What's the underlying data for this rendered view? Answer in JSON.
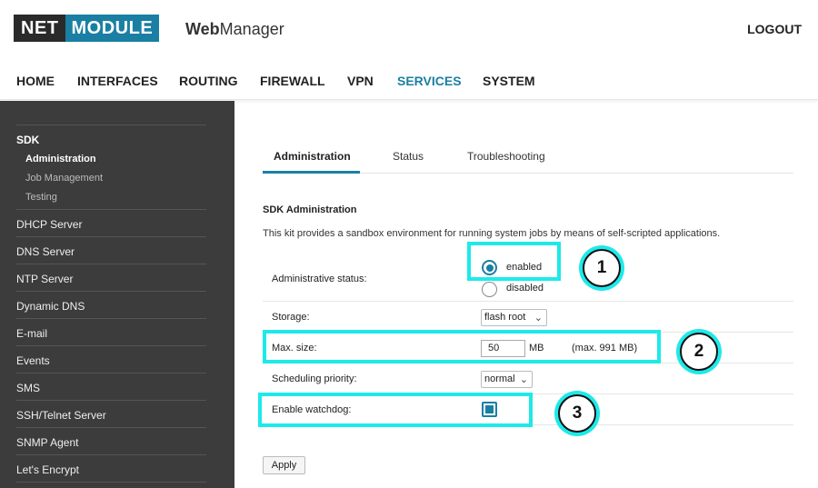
{
  "header": {
    "logo_net": "NET",
    "logo_module": "MODULE",
    "app_title_bold": "Web",
    "app_title_rest": "Manager",
    "logout": "LOGOUT"
  },
  "nav": {
    "items": [
      "HOME",
      "INTERFACES",
      "ROUTING",
      "FIREWALL",
      "VPN",
      "SERVICES",
      "SYSTEM"
    ],
    "active": "SERVICES"
  },
  "sidebar": {
    "section": "SDK",
    "sub_items": [
      "Administration",
      "Job Management",
      "Testing"
    ],
    "active_sub": "Administration",
    "items": [
      "DHCP Server",
      "DNS Server",
      "NTP Server",
      "Dynamic DNS",
      "E-mail",
      "Events",
      "SMS",
      "SSH/Telnet Server",
      "SNMP Agent",
      "Let's Encrypt"
    ]
  },
  "tabs": {
    "items": [
      "Administration",
      "Status",
      "Troubleshooting"
    ],
    "active": "Administration"
  },
  "form": {
    "title": "SDK Administration",
    "description": "This kit provides a sandbox environment for running system jobs by means of self-scripted applications.",
    "admin_status": {
      "label": "Administrative status:",
      "options": [
        "enabled",
        "disabled"
      ],
      "selected": "enabled"
    },
    "storage": {
      "label": "Storage:",
      "value": "flash root"
    },
    "max_size": {
      "label": "Max. size:",
      "value": "50",
      "unit": "MB",
      "hint": "(max. 991 MB)"
    },
    "scheduling": {
      "label": "Scheduling priority:",
      "value": "normal"
    },
    "watchdog": {
      "label": "Enable watchdog:",
      "checked": true
    },
    "apply": "Apply"
  },
  "annotations": {
    "color": "#1ee9e9",
    "badges": [
      "1",
      "2",
      "3"
    ]
  },
  "colors": {
    "brand": "#1a7fa3",
    "sidebar_bg": "#3c3c3c"
  }
}
